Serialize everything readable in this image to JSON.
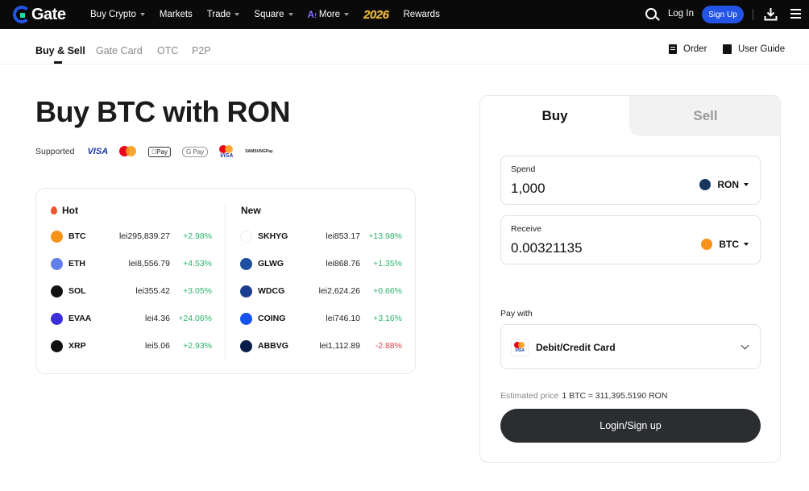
{
  "header": {
    "logo": "Gate",
    "nav": [
      {
        "label": "Buy Crypto",
        "dropdown": true
      },
      {
        "label": "Markets",
        "dropdown": false
      },
      {
        "label": "Trade",
        "dropdown": true
      },
      {
        "label": "Square",
        "dropdown": true
      },
      {
        "label": "More",
        "dropdown": true
      },
      {
        "label": "2026",
        "dropdown": false
      },
      {
        "label": "Rewards",
        "dropdown": false
      }
    ],
    "login": "Log In",
    "signup": "Sign Up"
  },
  "subnav": {
    "tabs": [
      "Buy & Sell",
      "Gate Card",
      "OTC",
      "P2P"
    ],
    "active_tab": "Buy & Sell",
    "order": "Order",
    "user_guide": "User Guide"
  },
  "main": {
    "title": "Buy BTC with RON",
    "supported_label": "Supported",
    "payment_methods": [
      "VISA",
      "Mastercard",
      "Apple Pay",
      "G Pay",
      "Mastercard Visa",
      "Samsung Pay"
    ],
    "visa_text": "VISA",
    "apple_pay_text": "Pay",
    "google_pay_text": "G Pay",
    "samsung_text_1": "SAMSUNG",
    "samsung_text_2": "Pay"
  },
  "markets": {
    "hot_label": "Hot",
    "new_label": "New",
    "hot": [
      {
        "symbol": "BTC",
        "price": "lei295,839.27",
        "change": "+2.98%",
        "dir": "up",
        "color": "#f7931a"
      },
      {
        "symbol": "ETH",
        "price": "lei8,556.79",
        "change": "+4.53%",
        "dir": "up",
        "color": "#627eea"
      },
      {
        "symbol": "SOL",
        "price": "lei355.42",
        "change": "+3.05%",
        "dir": "up",
        "color": "#111111"
      },
      {
        "symbol": "EVAA",
        "price": "lei4.36",
        "change": "+24.06%",
        "dir": "up",
        "color": "#3b2fd9"
      },
      {
        "symbol": "XRP",
        "price": "lei5.06",
        "change": "+2.93%",
        "dir": "up",
        "color": "#111111"
      }
    ],
    "new": [
      {
        "symbol": "SKHYG",
        "price": "lei853.17",
        "change": "+13.98%",
        "dir": "up",
        "color": "#ffffff"
      },
      {
        "symbol": "GLWG",
        "price": "lei868.76",
        "change": "+1.35%",
        "dir": "up",
        "color": "#1d4fa0"
      },
      {
        "symbol": "WDCG",
        "price": "lei2,624.26",
        "change": "+0.66%",
        "dir": "up",
        "color": "#1a3d8f"
      },
      {
        "symbol": "COING",
        "price": "lei746.10",
        "change": "+3.16%",
        "dir": "up",
        "color": "#1652f0"
      },
      {
        "symbol": "ABBVG",
        "price": "lei1,112.89",
        "change": "-2.88%",
        "dir": "down",
        "color": "#071d49"
      }
    ]
  },
  "trade": {
    "buy_tab": "Buy",
    "sell_tab": "Sell",
    "spend_label": "Spend",
    "spend_value": "1,000",
    "spend_currency": "RON",
    "receive_label": "Receive",
    "receive_value": "0.00321135",
    "receive_currency": "BTC",
    "pay_with_label": "Pay with",
    "pay_method": "Debit/Credit Card",
    "estimated_label": "Estimated price",
    "estimated_value": "1 BTC ≈ 311,395.5190 RON",
    "cta": "Login/Sign up"
  },
  "colors": {
    "accent": "#2354e6",
    "up": "#2bb36b",
    "down": "#e0424a",
    "cta": "#2b2d31"
  }
}
